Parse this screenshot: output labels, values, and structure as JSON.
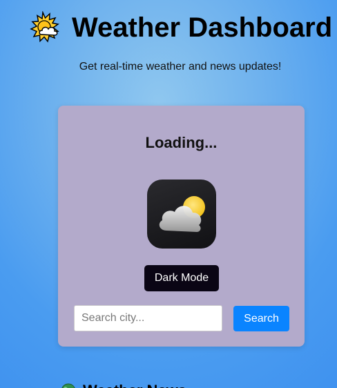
{
  "header": {
    "title": "Weather Dashboard",
    "subtitle": "Get real-time weather and news updates!",
    "icon": "sun-behind-cloud-icon"
  },
  "weather_card": {
    "status": "Loading...",
    "weather_icon": "partly-cloudy-app-icon",
    "dark_mode_label": "Dark Mode",
    "search": {
      "placeholder": "Search city...",
      "value": "",
      "button_label": "Search"
    }
  },
  "news": {
    "icon": "globe-icon",
    "title": "Weather News"
  },
  "colors": {
    "card_background": "#b3aacb",
    "dark_button": "#0a0514",
    "search_button": "#0a84ff"
  }
}
